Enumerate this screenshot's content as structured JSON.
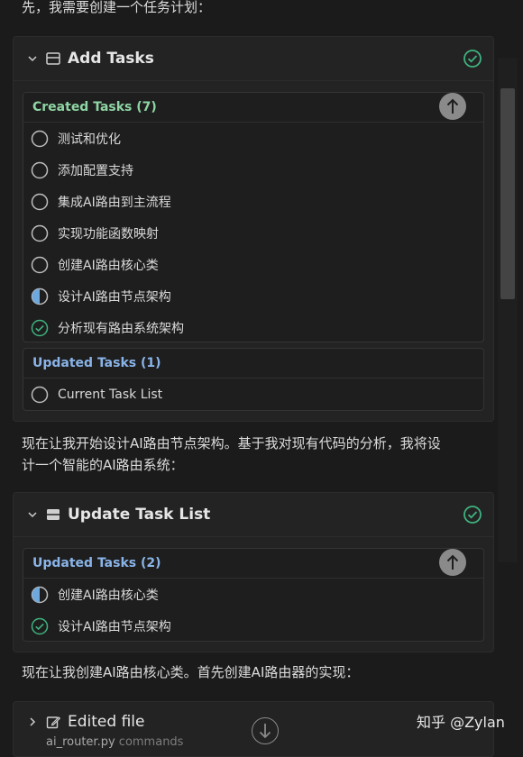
{
  "intro_text": "先，我需要创建一个任务计划：",
  "card1": {
    "title": "Add Tasks",
    "created": {
      "heading": "Created Tasks (7)",
      "color": "#8fd6a4",
      "tasks": [
        {
          "label": "测试和优化",
          "status": "pending"
        },
        {
          "label": "添加配置支持",
          "status": "pending"
        },
        {
          "label": "集成AI路由到主流程",
          "status": "pending"
        },
        {
          "label": "实现功能函数映射",
          "status": "pending"
        },
        {
          "label": "创建AI路由核心类",
          "status": "pending"
        },
        {
          "label": "设计AI路由节点架构",
          "status": "in-progress"
        },
        {
          "label": "分析现有路由系统架构",
          "status": "completed"
        }
      ]
    },
    "updated": {
      "heading": "Updated Tasks (1)",
      "color": "#8ab4e8",
      "tasks": [
        {
          "label": "Current Task List",
          "status": "pending"
        }
      ]
    }
  },
  "mid_text_1": "现在让我开始设计AI路由节点架构。基于我对现有代码的分析，我将设",
  "mid_text_2": "计一个智能的AI路由系统：",
  "card2": {
    "title": "Update Task List",
    "updated": {
      "heading": "Updated Tasks (2)",
      "color": "#8ab4e8",
      "tasks": [
        {
          "label": "创建AI路由核心类",
          "status": "in-progress"
        },
        {
          "label": "设计AI路由节点架构",
          "status": "completed"
        }
      ]
    }
  },
  "bottom_text": "现在让我创建AI路由核心类。首先创建AI路由器的实现：",
  "card3": {
    "title": "Edited file",
    "subtitle_file": "ai_router.py",
    "subtitle_dir": "commands"
  },
  "watermark": "知乎 @Zylan",
  "colors": {
    "accent_green": "#3fb27f",
    "in_progress": "#6fa8dc"
  }
}
